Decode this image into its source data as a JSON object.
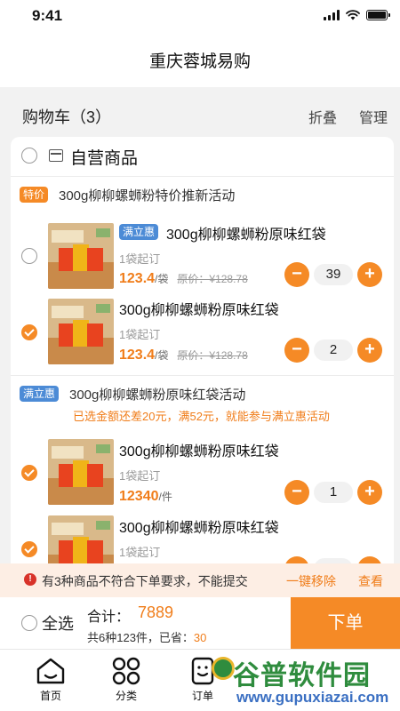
{
  "status_bar": {
    "time": "9:41"
  },
  "nav": {
    "title": "重庆蓉城易购"
  },
  "cart": {
    "title": "购物车（3）",
    "collapse_label": "折叠",
    "manage_label": "管理"
  },
  "store": {
    "name": "自营商品"
  },
  "groups": [
    {
      "tag": "特价",
      "title": "300g柳柳螺蛳粉特价推新活动",
      "items": [
        {
          "badge": "满立惠",
          "name": "300g柳柳螺蛳粉原味红袋",
          "min_order": "1袋起订",
          "price": "123.4",
          "unit": "/袋",
          "original_price": "原价：¥128.78",
          "quantity": "39",
          "checked": false
        },
        {
          "name": "300g柳柳螺蛳粉原味红袋",
          "min_order": "1袋起订",
          "price": "123.4",
          "unit": "/袋",
          "original_price": "原价：¥128.78",
          "quantity": "2",
          "checked": true
        }
      ]
    },
    {
      "tag": "满立惠",
      "title": "300g柳柳螺蛳粉原味红袋活动",
      "hint": "已选金额还差20元，满52元，就能参与满立惠活动",
      "items": [
        {
          "name": "300g柳柳螺蛳粉原味红袋",
          "min_order": "1袋起订",
          "price": "12340",
          "unit": "/件",
          "quantity": "1",
          "checked": true
        },
        {
          "name": "300g柳柳螺蛳粉原味红袋",
          "min_order": "1袋起订",
          "checked": true
        }
      ]
    }
  ],
  "warning": {
    "text": "有3种商品不符合下单要求，不能提交",
    "remove_label": "一键移除",
    "view_label": "查看"
  },
  "checkout": {
    "select_all_label": "全选",
    "total_label": "合计：",
    "total_value": "7889",
    "summary_prefix": "共6种123件，已省：",
    "saved_value": "30",
    "submit_label": "下单"
  },
  "tabbar": {
    "items": [
      {
        "label": "首页",
        "icon": "home-icon"
      },
      {
        "label": "分类",
        "icon": "category-icon"
      },
      {
        "label": "订单",
        "icon": "order-icon"
      }
    ]
  },
  "watermark": {
    "text": "谷普软件园",
    "url": "www.gupuxiazai.com"
  },
  "colors": {
    "accent": "#f58a26",
    "blue_tag": "#4c8bd6",
    "warning_bg": "#fdeee4"
  }
}
